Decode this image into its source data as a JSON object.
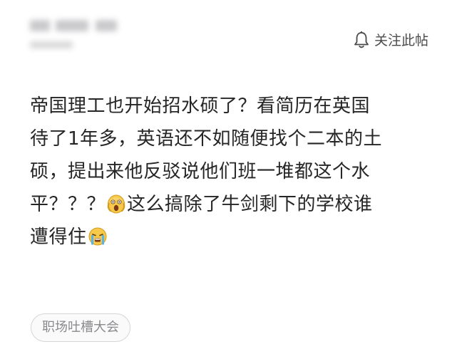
{
  "header": {
    "follow_label": "关注此帖",
    "follow_icon": "bell-icon"
  },
  "post": {
    "lines": [
      "帝国理工也开始招水硕了？看简历在英国",
      "待了1年多，英语还不如随便找个二本的土",
      "硕，提出来他反驳说他们班一堆都这个水",
      {
        "before": "平？？？",
        "emoji": "shocked-face-emoji",
        "after": "这么搞除了牛剑剩下的学校谁"
      },
      {
        "before": "遭得住",
        "emoji": "crying-face-emoji",
        "after": ""
      }
    ]
  },
  "footer": {
    "tag_label": "职场吐槽大会"
  },
  "colors": {
    "background": "#ffffff",
    "text": "#262626",
    "tag_border": "#d5d5d8",
    "tag_text": "#8a8a8e"
  }
}
